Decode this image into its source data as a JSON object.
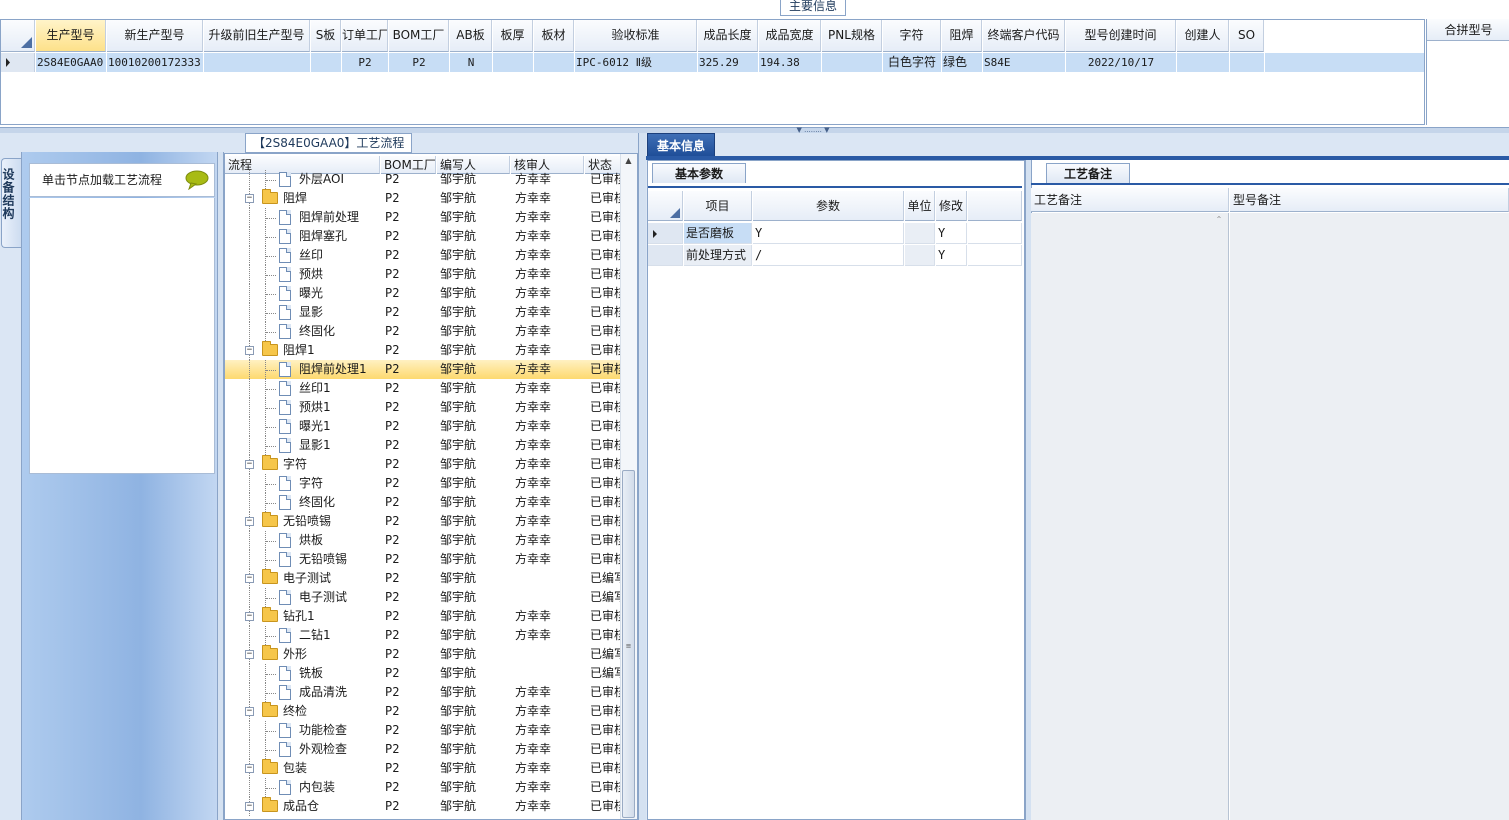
{
  "top": {
    "caption": "主要信息",
    "columns": [
      "生产型号",
      "新生产型号",
      "升级前旧生产型号",
      "S板",
      "订单工厂",
      "BOM工厂",
      "AB板",
      "板厚",
      "板材",
      "验收标准",
      "成品长度",
      "成品宽度",
      "PNL规格",
      "字符",
      "阻焊",
      "终端客户代码",
      "型号创建时间",
      "创建人",
      "SO"
    ],
    "row": [
      "2S84E0GAA0",
      "10010200172333",
      "",
      "",
      "P2",
      "P2",
      "N",
      "",
      "",
      "IPC-6012 Ⅱ级",
      "325.29",
      "194.38",
      "",
      "白色字符",
      "绿色",
      "S84E",
      "2022/10/17",
      "",
      ""
    ],
    "combine_header": "合拼型号"
  },
  "device": {
    "tab_label": "设备结构",
    "hint": "单击节点加载工艺流程"
  },
  "tree": {
    "caption": "【2S84E0GAA0】工艺流程",
    "headers": [
      "流程",
      "BOM工厂",
      "编写人",
      "核审人",
      "状态"
    ],
    "rows": [
      {
        "name": "外层AOI",
        "level": 2,
        "factory": "P2",
        "writer": "邹宇航",
        "reviewer": "方幸幸",
        "status": "已审核"
      },
      {
        "name": "阻焊",
        "level": 1,
        "factory": "P2",
        "writer": "邹宇航",
        "reviewer": "方幸幸",
        "status": "已审核"
      },
      {
        "name": "阻焊前处理",
        "level": 2,
        "factory": "P2",
        "writer": "邹宇航",
        "reviewer": "方幸幸",
        "status": "已审核"
      },
      {
        "name": "阻焊塞孔",
        "level": 2,
        "factory": "P2",
        "writer": "邹宇航",
        "reviewer": "方幸幸",
        "status": "已审核"
      },
      {
        "name": "丝印",
        "level": 2,
        "factory": "P2",
        "writer": "邹宇航",
        "reviewer": "方幸幸",
        "status": "已审核"
      },
      {
        "name": "预烘",
        "level": 2,
        "factory": "P2",
        "writer": "邹宇航",
        "reviewer": "方幸幸",
        "status": "已审核"
      },
      {
        "name": "曝光",
        "level": 2,
        "factory": "P2",
        "writer": "邹宇航",
        "reviewer": "方幸幸",
        "status": "已审核"
      },
      {
        "name": "显影",
        "level": 2,
        "factory": "P2",
        "writer": "邹宇航",
        "reviewer": "方幸幸",
        "status": "已审核"
      },
      {
        "name": "终固化",
        "level": 2,
        "factory": "P2",
        "writer": "邹宇航",
        "reviewer": "方幸幸",
        "status": "已审核"
      },
      {
        "name": "阻焊1",
        "level": 1,
        "factory": "P2",
        "writer": "邹宇航",
        "reviewer": "方幸幸",
        "status": "已审核"
      },
      {
        "name": "阻焊前处理1",
        "level": 2,
        "factory": "P2",
        "writer": "邹宇航",
        "reviewer": "方幸幸",
        "status": "已审核",
        "selected": true
      },
      {
        "name": "丝印1",
        "level": 2,
        "factory": "P2",
        "writer": "邹宇航",
        "reviewer": "方幸幸",
        "status": "已审核"
      },
      {
        "name": "预烘1",
        "level": 2,
        "factory": "P2",
        "writer": "邹宇航",
        "reviewer": "方幸幸",
        "status": "已审核"
      },
      {
        "name": "曝光1",
        "level": 2,
        "factory": "P2",
        "writer": "邹宇航",
        "reviewer": "方幸幸",
        "status": "已审核"
      },
      {
        "name": "显影1",
        "level": 2,
        "factory": "P2",
        "writer": "邹宇航",
        "reviewer": "方幸幸",
        "status": "已审核"
      },
      {
        "name": "字符",
        "level": 1,
        "factory": "P2",
        "writer": "邹宇航",
        "reviewer": "方幸幸",
        "status": "已审核"
      },
      {
        "name": "字符",
        "level": 2,
        "factory": "P2",
        "writer": "邹宇航",
        "reviewer": "方幸幸",
        "status": "已审核"
      },
      {
        "name": "终固化",
        "level": 2,
        "factory": "P2",
        "writer": "邹宇航",
        "reviewer": "方幸幸",
        "status": "已审核"
      },
      {
        "name": "无铅喷锡",
        "level": 1,
        "factory": "P2",
        "writer": "邹宇航",
        "reviewer": "方幸幸",
        "status": "已审核"
      },
      {
        "name": "烘板",
        "level": 2,
        "factory": "P2",
        "writer": "邹宇航",
        "reviewer": "方幸幸",
        "status": "已审核"
      },
      {
        "name": "无铅喷锡",
        "level": 2,
        "factory": "P2",
        "writer": "邹宇航",
        "reviewer": "方幸幸",
        "status": "已审核"
      },
      {
        "name": "电子测试",
        "level": 1,
        "factory": "P2",
        "writer": "邹宇航",
        "reviewer": "",
        "status": "已编写"
      },
      {
        "name": "电子测试",
        "level": 2,
        "factory": "P2",
        "writer": "邹宇航",
        "reviewer": "",
        "status": "已编写"
      },
      {
        "name": "钻孔1",
        "level": 1,
        "factory": "P2",
        "writer": "邹宇航",
        "reviewer": "方幸幸",
        "status": "已审核"
      },
      {
        "name": "二钻1",
        "level": 2,
        "factory": "P2",
        "writer": "邹宇航",
        "reviewer": "方幸幸",
        "status": "已审核"
      },
      {
        "name": "外形",
        "level": 1,
        "factory": "P2",
        "writer": "邹宇航",
        "reviewer": "",
        "status": "已编写"
      },
      {
        "name": "铣板",
        "level": 2,
        "factory": "P2",
        "writer": "邹宇航",
        "reviewer": "",
        "status": "已编写"
      },
      {
        "name": "成品清洗",
        "level": 2,
        "factory": "P2",
        "writer": "邹宇航",
        "reviewer": "方幸幸",
        "status": "已审核"
      },
      {
        "name": "终检",
        "level": 1,
        "factory": "P2",
        "writer": "邹宇航",
        "reviewer": "方幸幸",
        "status": "已审核"
      },
      {
        "name": "功能检查",
        "level": 2,
        "factory": "P2",
        "writer": "邹宇航",
        "reviewer": "方幸幸",
        "status": "已审核"
      },
      {
        "name": "外观检查",
        "level": 2,
        "factory": "P2",
        "writer": "邹宇航",
        "reviewer": "方幸幸",
        "status": "已审核"
      },
      {
        "name": "包装",
        "level": 1,
        "factory": "P2",
        "writer": "邹宇航",
        "reviewer": "方幸幸",
        "status": "已审核"
      },
      {
        "name": "内包装",
        "level": 2,
        "factory": "P2",
        "writer": "邹宇航",
        "reviewer": "方幸幸",
        "status": "已审核"
      },
      {
        "name": "成品仓",
        "level": 1,
        "factory": "P2",
        "writer": "邹宇航",
        "reviewer": "方幸幸",
        "status": "已审核"
      }
    ]
  },
  "basic": {
    "tab_label": "基本信息",
    "param_tab": "基本参数",
    "headers": [
      "项目",
      "参数",
      "单位",
      "修改"
    ],
    "rows": [
      {
        "item": "是否磨板",
        "param": "Y",
        "unit": "",
        "modify": "Y"
      },
      {
        "item": "前处理方式",
        "param": "/",
        "unit": "",
        "modify": "Y"
      }
    ]
  },
  "notes": {
    "tab_label": "工艺备注",
    "headers": [
      "工艺备注",
      "型号备注"
    ]
  },
  "colors": {
    "accent": "#2a5aa5",
    "selection": "#c7ddf5",
    "tree_selection": "#fdd96f",
    "panel_blue": "#8fb3e2"
  }
}
